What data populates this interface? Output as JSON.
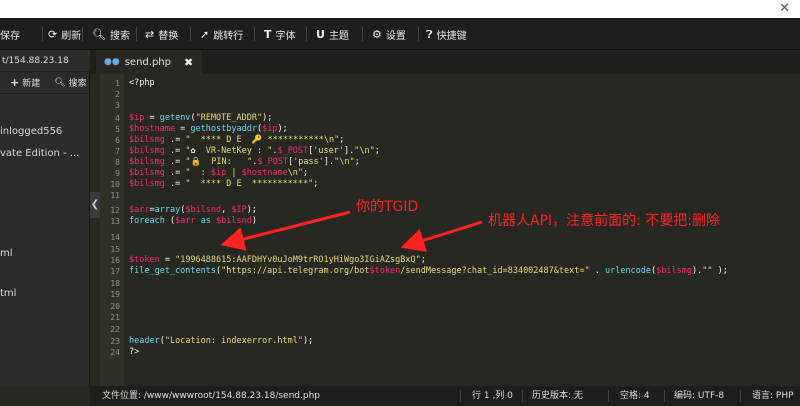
{
  "toolbar": {
    "items": [
      {
        "label": "保存",
        "icon": "save-icon"
      },
      {
        "label": "刷新",
        "icon": "refresh-icon"
      },
      {
        "label": "搜索",
        "icon": "search-icon"
      },
      {
        "label": "替换",
        "icon": "replace-icon"
      },
      {
        "label": "跳转行",
        "icon": "goto-line-icon"
      },
      {
        "label": "字体",
        "icon": "font-icon"
      },
      {
        "label": "主题",
        "icon": "theme-icon"
      },
      {
        "label": "设置",
        "icon": "gear-icon"
      },
      {
        "label": "快捷键",
        "icon": "help-icon"
      }
    ]
  },
  "sidebar": {
    "path": "t/154.88.23.18",
    "new_label": "新建",
    "search_label": "搜索",
    "files": [
      "inlogged556",
      "vate Edition - ...",
      "ml",
      "tml"
    ]
  },
  "tab": {
    "label": "send.php",
    "close": "✖"
  },
  "editor": {
    "line_numbers": [
      "1",
      "2",
      "3",
      "4",
      "5",
      "6",
      "7",
      "8",
      "9",
      "10",
      "11",
      "12",
      "13",
      "14",
      "15",
      "16",
      "17",
      "18",
      "19",
      "20",
      "21",
      "22",
      "23",
      "24"
    ]
  },
  "annotations": {
    "tgid": "你的TGID",
    "api": "机器人API，注意前面的: 不要把:删除"
  },
  "statusbar": {
    "file_location": "文件位置: /www/wwwroot/154.88.23.18/send.php",
    "cursor": "行 1 ,列 0",
    "history": "历史版本: 无",
    "spaces": "空格: 4",
    "encoding": "编码: UTF-8",
    "language": "语言: PHP"
  },
  "colors": {
    "background": "#272822",
    "variable": "#f92672",
    "string": "#e6db74",
    "function": "#66d9ef",
    "annotation": "#ff2222"
  }
}
